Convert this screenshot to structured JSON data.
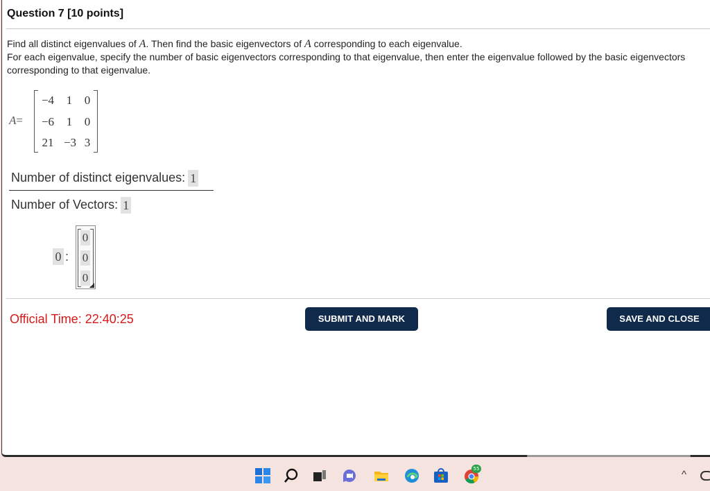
{
  "question": {
    "title": "Question 7 [10 points]",
    "instructions": {
      "line1_a": "Find all distinct eigenvalues of ",
      "line1_var1": "A",
      "line1_b": ". Then find the basic eigenvectors of ",
      "line1_var2": "A",
      "line1_c": " corresponding to each eigenvalue.",
      "line2": "For each eigenvalue, specify the number of basic eigenvectors corresponding to that eigenvalue, then enter the eigenvalue followed by the basic eigenvectors corresponding to that eigenvalue."
    }
  },
  "matrix": {
    "name": "A",
    "equals": "=",
    "rows": [
      [
        "−4",
        "1",
        "0"
      ],
      [
        "−6",
        "1",
        "0"
      ],
      [
        "21",
        "−3",
        "3"
      ]
    ]
  },
  "answers": {
    "distinct_eigenvalues_label": "Number of distinct eigenvalues:",
    "distinct_eigenvalues_value": "1",
    "vectors_label": "Number of Vectors:",
    "vectors_value": "1",
    "eigenvalue_value": "0",
    "colon": ":",
    "eigenvector": [
      "0",
      "0",
      "0"
    ]
  },
  "footer": {
    "timer": "Official Time: 22:40:25",
    "submit_label": "SUBMIT AND MARK",
    "save_label": "SAVE AND CLOSE"
  },
  "taskbar": {
    "badge": "55",
    "icons": [
      "windows-start-icon",
      "search-icon",
      "task-view-icon",
      "teams-chat-icon",
      "file-explorer-icon",
      "edge-browser-icon",
      "microsoft-store-icon",
      "chrome-browser-icon"
    ]
  }
}
